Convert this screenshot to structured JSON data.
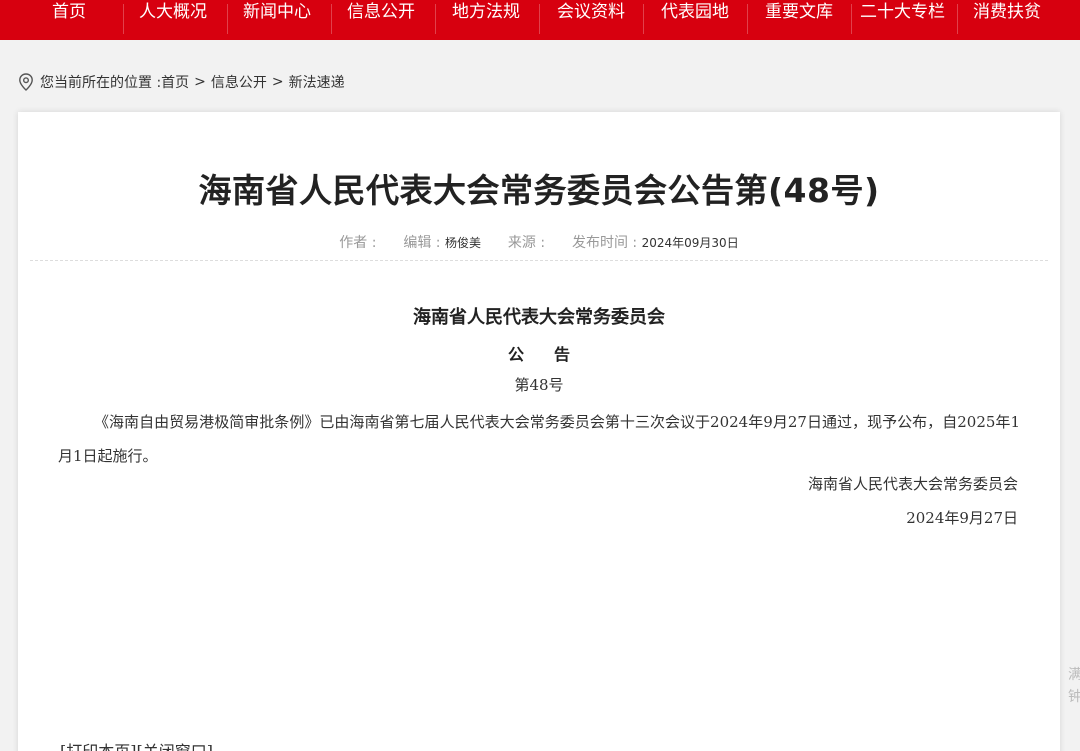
{
  "nav": {
    "items": [
      "首页",
      "人大概况",
      "新闻中心",
      "信息公开",
      "地方法规",
      "会议资料",
      "代表园地",
      "重要文库",
      "二十大专栏",
      "消费扶贫"
    ],
    "color": "#d7000f"
  },
  "breadcrumb": {
    "icon": "location-pin-icon",
    "prefix": "您当前所在的位置 : ",
    "items": [
      "首页",
      "信息公开",
      "新法速递"
    ],
    "separator": ">"
  },
  "article": {
    "title": "海南省人民代表大会常务委员会公告第(48号)",
    "meta": {
      "author_label": "作者 :",
      "author": "",
      "editor_label": "编辑 :",
      "editor": "杨俊美",
      "source_label": "来源 :",
      "source": "",
      "date_label": "发布时间 :",
      "date": "2024年09月30日"
    },
    "org_heading": "海南省人民代表大会常务委员会",
    "notice_heading": "公告",
    "doc_number": "第48号",
    "body": "《海南自由贸易港极简审批条例》已由海南省第七届人民代表大会常务委员会第十三次会议于2024年9月27日通过，现予公布，自2025年1月1日起施行。",
    "signature_org": "海南省人民代表大会常务委员会",
    "signature_date": "2024年9月27日"
  },
  "footer_links": {
    "print": "[打印本页]",
    "close": "[关闭窗口]"
  },
  "side_tab": "满\n钟"
}
